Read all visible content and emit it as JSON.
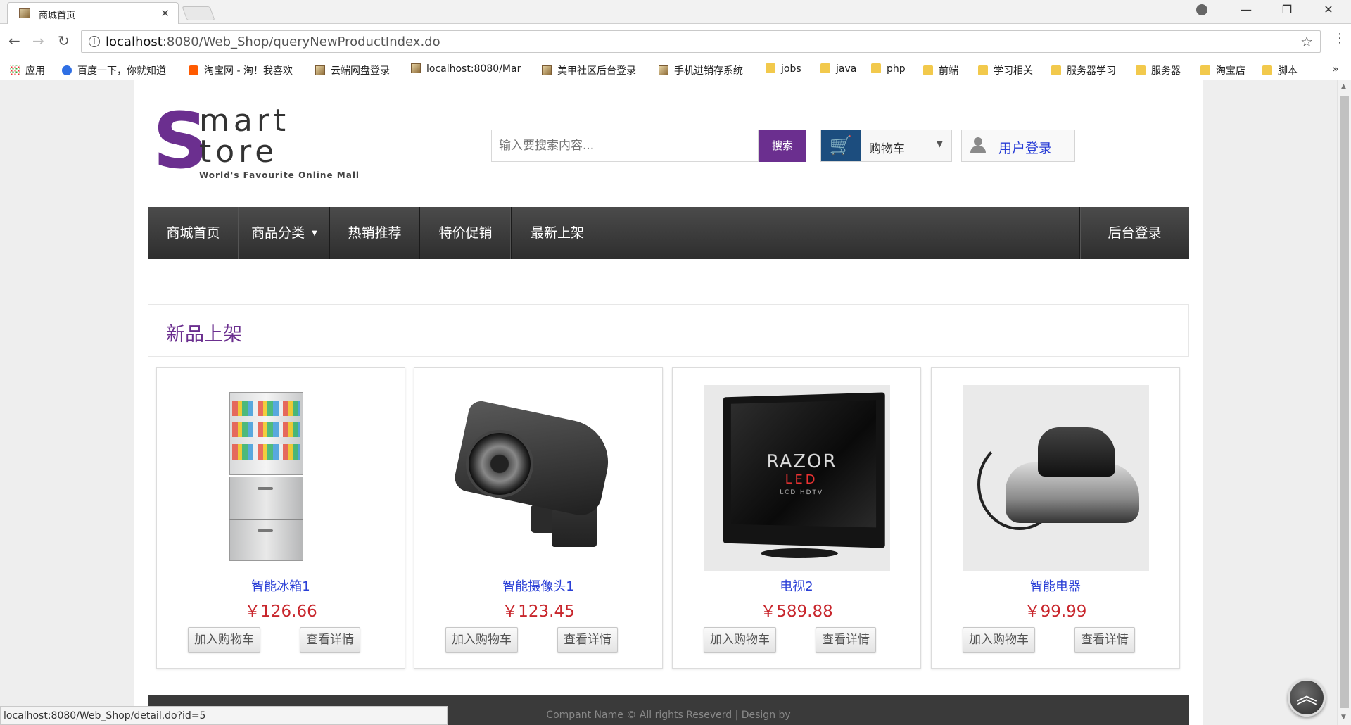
{
  "browser": {
    "tab_title": "商城首页",
    "url_host": "localhost",
    "url_rest": ":8080/Web_Shop/queryNewProductIndex.do",
    "status_url": "localhost:8080/Web_Shop/detail.do?id=5"
  },
  "bookmarks": [
    {
      "label": "应用",
      "icon": "apps"
    },
    {
      "label": "百度一下，你就知道",
      "icon": "baidu"
    },
    {
      "label": "淘宝网 - 淘！我喜欢",
      "icon": "taobao"
    },
    {
      "label": "云端网盘登录",
      "icon": "page"
    },
    {
      "label": "localhost:8080/Mar",
      "icon": "page"
    },
    {
      "label": "美甲社区后台登录",
      "icon": "page"
    },
    {
      "label": "手机进销存系统",
      "icon": "page"
    },
    {
      "label": "jobs",
      "icon": "folder"
    },
    {
      "label": "java",
      "icon": "folder"
    },
    {
      "label": "php",
      "icon": "folder"
    },
    {
      "label": "前端",
      "icon": "folder"
    },
    {
      "label": "学习相关",
      "icon": "folder"
    },
    {
      "label": "服务器学习",
      "icon": "folder"
    },
    {
      "label": "服务器",
      "icon": "folder"
    },
    {
      "label": "淘宝店",
      "icon": "folder"
    },
    {
      "label": "脚本",
      "icon": "folder"
    }
  ],
  "logo": {
    "letter_s": "S",
    "line1": "mart",
    "line2": "tore",
    "tagline": "World's Favourite Online Mall"
  },
  "search": {
    "placeholder": "输入要搜索内容...",
    "button": "搜索"
  },
  "cart": {
    "label": "购物车"
  },
  "login": {
    "label": "用户登录"
  },
  "nav": {
    "items": [
      "商城首页",
      "商品分类",
      "热销推荐",
      "特价促销",
      "最新上架"
    ],
    "admin": "后台登录"
  },
  "section": {
    "title": "新品上架"
  },
  "products": [
    {
      "name": "智能冰箱1",
      "price": "￥126.66",
      "add_cart": "加入购物车",
      "detail": "查看详情"
    },
    {
      "name": "智能摄像头1",
      "price": "￥123.45",
      "add_cart": "加入购物车",
      "detail": "查看详情"
    },
    {
      "name": "电视2",
      "price": "￥589.88",
      "add_cart": "加入购物车",
      "detail": "查看详情",
      "tv_brand": "RAZOR",
      "tv_led": "LED",
      "tv_sub": "LCD HDTV"
    },
    {
      "name": "智能电器",
      "price": "￥99.99",
      "add_cart": "加入购物车",
      "detail": "查看详情"
    }
  ],
  "footer": {
    "copyright": "Compant Name © All rights Reseverd | Design by"
  },
  "colors": {
    "brand_purple": "#6b2f8f",
    "cart_blue": "#1c4d7e",
    "price_red": "#c8262c",
    "link_blue": "#2a3fd6"
  }
}
